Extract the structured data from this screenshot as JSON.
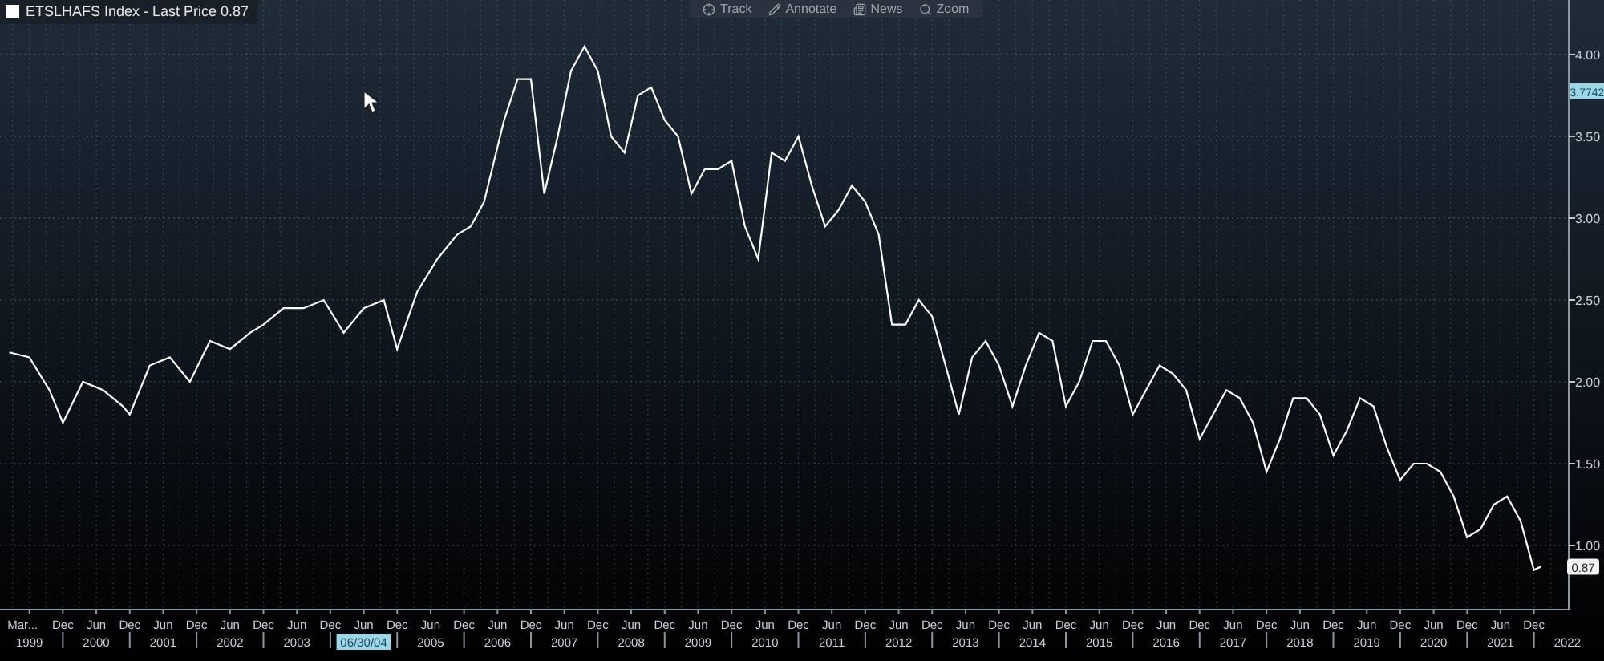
{
  "legend": {
    "suffix": "- Last Price 0.87"
  },
  "toolbar": [
    {
      "label": "Track",
      "kind": "track"
    },
    {
      "label": "Annotate",
      "kind": "annotate"
    },
    {
      "label": "News",
      "kind": "news"
    },
    {
      "label": "Zoom",
      "kind": "zoom"
    }
  ],
  "chart": {
    "last_price_tag": "0.87",
    "crosshair": {
      "date": "06/30/04",
      "value": "3.7742"
    },
    "x_axis": {
      "months": [
        "Mar",
        "...",
        "Dec",
        "Jun",
        "Dec",
        "Jun",
        "Dec",
        "Jun",
        "Dec",
        "Jun",
        "Dec",
        "Jun",
        "Dec",
        "Jun",
        "Dec",
        "Jun",
        "Dec",
        "Jun",
        "Dec",
        "Jun",
        "Dec",
        "Jun",
        "Dec",
        "Jun",
        "Dec",
        "Jun",
        "Dec",
        "Jun",
        "Dec",
        "Jun",
        "Dec",
        "Jun",
        "Dec",
        "Jun",
        "Dec",
        "Jun",
        "Dec",
        "Jun",
        "Dec",
        "Jun",
        "Dec",
        "Jun",
        "Dec",
        "Jun",
        "Dec",
        "Jun",
        "Dec"
      ]
    },
    "chart_data": {
      "type": "line",
      "grid": true,
      "xlim": [
        1998.56,
        2022.02
      ],
      "ylim": [
        0.608,
        4.333
      ],
      "x": [
        1998.7,
        1999.0,
        1999.3,
        1999.5,
        1999.8,
        2000.1,
        2000.4,
        2000.5,
        2000.8,
        2001.1,
        2001.4,
        2001.7,
        2002.0,
        2002.3,
        2002.5,
        2002.8,
        2003.1,
        2003.4,
        2003.7,
        2004.0,
        2004.3,
        2004.5,
        2004.8,
        2005.1,
        2005.4,
        2005.6,
        2005.8,
        2006.1,
        2006.3,
        2006.5,
        2006.7,
        2006.9,
        2007.1,
        2007.3,
        2007.5,
        2007.7,
        2007.9,
        2008.1,
        2008.3,
        2008.5,
        2008.7,
        2008.9,
        2009.1,
        2009.3,
        2009.5,
        2009.7,
        2009.9,
        2010.1,
        2010.3,
        2010.5,
        2010.7,
        2010.9,
        2011.1,
        2011.3,
        2011.5,
        2011.7,
        2011.9,
        2012.1,
        2012.3,
        2012.5,
        2012.7,
        2012.9,
        2013.1,
        2013.3,
        2013.5,
        2013.7,
        2013.9,
        2014.1,
        2014.3,
        2014.5,
        2014.7,
        2014.9,
        2015.1,
        2015.3,
        2015.5,
        2015.7,
        2015.9,
        2016.1,
        2016.3,
        2016.5,
        2016.7,
        2016.9,
        2017.1,
        2017.3,
        2017.5,
        2017.7,
        2017.9,
        2018.1,
        2018.3,
        2018.5,
        2018.7,
        2018.9,
        2019.1,
        2019.3,
        2019.5,
        2019.7,
        2019.9,
        2020.1,
        2020.3,
        2020.5,
        2020.7,
        2020.9,
        2021.1,
        2021.3,
        2021.5,
        2021.6
      ],
      "series": [
        {
          "name": "ETSLHAFS Index",
          "color": "#ffffff",
          "values": [
            2.18,
            2.15,
            1.95,
            1.75,
            2.0,
            1.95,
            1.85,
            1.8,
            2.1,
            2.15,
            2.0,
            2.25,
            2.2,
            2.3,
            2.35,
            2.45,
            2.45,
            2.5,
            2.3,
            2.45,
            2.5,
            2.2,
            2.55,
            2.75,
            2.9,
            2.95,
            3.1,
            3.6,
            3.85,
            3.85,
            3.15,
            3.5,
            3.9,
            4.05,
            3.9,
            3.5,
            3.4,
            3.75,
            3.8,
            3.6,
            3.5,
            3.15,
            3.3,
            3.3,
            3.35,
            2.95,
            2.75,
            3.4,
            3.35,
            3.5,
            3.2,
            2.95,
            3.05,
            3.2,
            3.1,
            2.9,
            2.35,
            2.35,
            2.5,
            2.4,
            2.1,
            1.8,
            2.15,
            2.25,
            2.1,
            1.85,
            2.1,
            2.3,
            2.25,
            1.85,
            2.0,
            2.25,
            2.25,
            2.1,
            1.8,
            1.95,
            2.1,
            2.05,
            1.95,
            1.65,
            1.8,
            1.95,
            1.9,
            1.75,
            1.45,
            1.65,
            1.9,
            1.9,
            1.8,
            1.55,
            1.7,
            1.9,
            1.85,
            1.6,
            1.4,
            1.5,
            1.5,
            1.45,
            1.3,
            1.05,
            1.1,
            1.25,
            1.3,
            1.15,
            0.85,
            0.87
          ]
        }
      ],
      "yticks": [
        {
          "value": 1,
          "label": "1.00"
        },
        {
          "value": 1.5,
          "label": "1.50"
        },
        {
          "value": 2,
          "label": "2.00"
        },
        {
          "value": 2.5,
          "label": "2.50"
        },
        {
          "value": 3,
          "label": "3.00"
        },
        {
          "value": 3.5,
          "label": "3.50"
        },
        {
          "value": 4,
          "label": "4.00"
        }
      ],
      "xticks": [
        1999,
        2000,
        2001,
        2002,
        2003,
        2005,
        2006,
        2007,
        2008,
        2009,
        2010,
        2011,
        2012,
        2013,
        2014,
        2015,
        2016,
        2017,
        2018,
        2019,
        2020,
        2021,
        2022
      ]
    }
  }
}
